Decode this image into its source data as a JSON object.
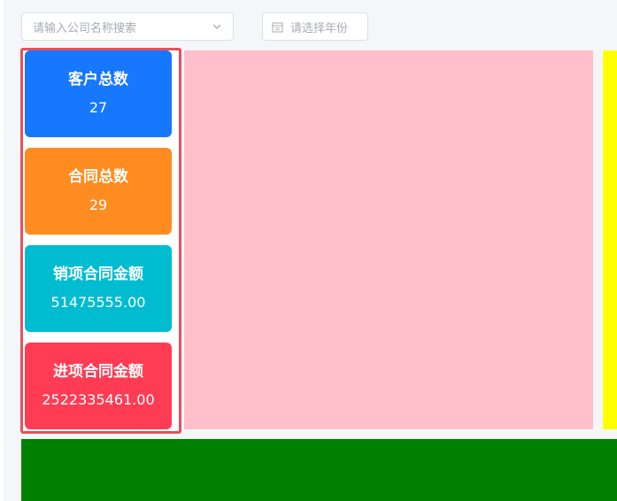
{
  "filters": {
    "company_search_placeholder": "请输入公司名称搜索",
    "year_placeholder": "请选择年份",
    "company_icon": "chevron-down-icon",
    "year_icon": "calendar-icon"
  },
  "stats": [
    {
      "label": "客户总数",
      "value": "27",
      "color": "#1677ff"
    },
    {
      "label": "合同总数",
      "value": "29",
      "color": "#ff8c21"
    },
    {
      "label": "销项合同金额",
      "value": "51475555.00",
      "color": "#00bcd0"
    },
    {
      "label": "进项合同金额",
      "value": "2522335461.00",
      "color": "#ff3c54"
    }
  ],
  "colors": {
    "panel_border": "#e8505a",
    "pink_area": "#ffc0cb",
    "yellow_area": "#ffff00",
    "green_area": "#008000"
  }
}
